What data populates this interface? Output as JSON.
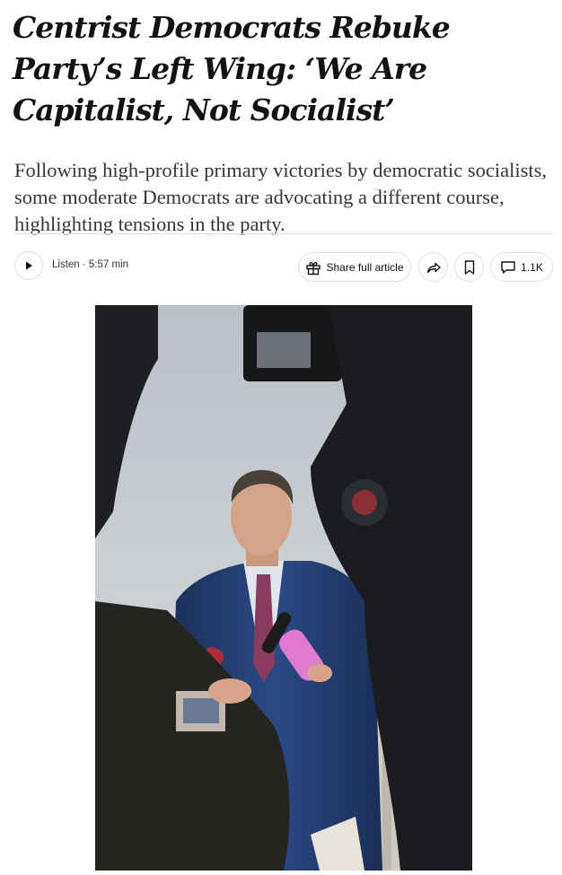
{
  "article": {
    "headline": "Centrist Democrats Rebuke Party’s Left Wing: ‘We Are Capitalist, Not Socialist’",
    "summary": "Following high-profile primary victories by democratic socialists, some moderate Democrats are advocating a different course, highlighting tensions in the party."
  },
  "toolbar": {
    "listen_label": "Listen · 5:57 min",
    "share_label": "Share full article",
    "comments_count": "1.1K",
    "icons": {
      "play": "play-icon",
      "gift": "gift-icon",
      "share": "share-arrow-icon",
      "save": "bookmark-icon",
      "comments": "comment-bubble-icon"
    }
  },
  "photo": {
    "subject": "man in blue suit speaking to reporters with microphones and cameras"
  },
  "colors": {
    "text": "#121212",
    "summary_text": "#363636",
    "rule": "#dfdfdf",
    "suit": "#1f3a6b",
    "tie": "#8b3b5e",
    "sky": "#c9ced3"
  }
}
